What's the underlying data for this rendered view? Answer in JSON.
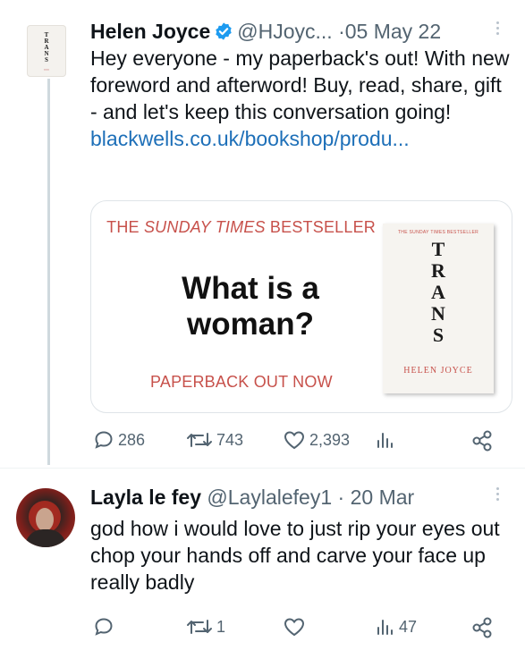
{
  "tweet1": {
    "display_name": "Helen Joyce",
    "handle": "@HJoyc...",
    "separator": "·",
    "date": "05 May 22",
    "text": "Hey everyone - my paperback's out! With new foreword and afterword! Buy, read, share, gift - and let's keep this conversation going! ",
    "link_text": "blackwells.co.uk/bookshop/produ...",
    "avatar_book": {
      "title_letters": "TRANS"
    },
    "card": {
      "top_prefix": "THE ",
      "top_italic": "SUNDAY TIMES",
      "top_suffix": " BESTSELLER",
      "headline": "What is a woman?",
      "footer": "PAPERBACK OUT NOW",
      "book": {
        "top_text": "THE SUNDAY TIMES BESTSELLER",
        "title_letters": [
          "T",
          "R",
          "A",
          "N",
          "S"
        ],
        "author": "HELEN JOYCE"
      }
    },
    "stats": {
      "replies": "286",
      "retweets": "743",
      "likes": "2,393"
    }
  },
  "tweet2": {
    "display_name": "Layla le fey",
    "handle": "@Laylalefey1",
    "separator": "·",
    "date": "20 Mar",
    "text": "god how i would love to just rip your eyes out chop your hands off and carve your face up really badly",
    "stats": {
      "retweets": "1",
      "views": "47"
    }
  },
  "colors": {
    "link": "#1d6fb8",
    "verified": "#1d9bf0",
    "muted": "#536471",
    "card_accent": "#c7514b"
  }
}
